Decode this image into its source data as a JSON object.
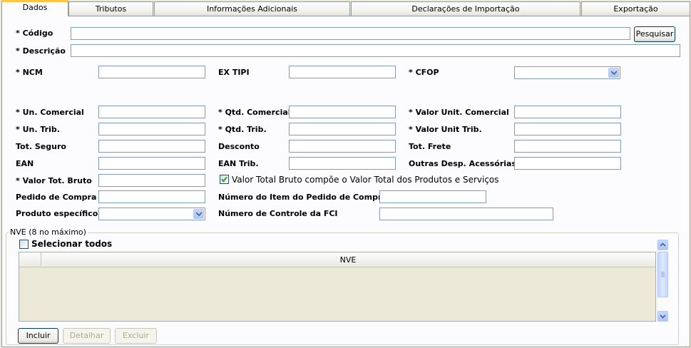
{
  "tabs": [
    {
      "label": "Dados"
    },
    {
      "label": "Tributos"
    },
    {
      "label": "Informações Adicionais"
    },
    {
      "label": "Declarações de Importação"
    },
    {
      "label": "Exportação"
    }
  ],
  "form": {
    "codigo_label": "* Código",
    "descricao_label": "* Descrição",
    "pesquisar_label": "Pesquisar",
    "ncm_label": "* NCM",
    "extipi_label": "EX TIPI",
    "cfop_label": "* CFOP",
    "un_comercial_label": "* Un. Comercial",
    "qtd_comercial_label": "* Qtd. Comercial",
    "valor_unit_comercial_label": "* Valor Unit. Comercial",
    "un_trib_label": "* Un. Trib.",
    "qtd_trib_label": "* Qtd. Trib.",
    "valor_unit_trib_label": "* Valor Unit Trib.",
    "tot_seguro_label": "Tot. Seguro",
    "desconto_label": "Desconto",
    "tot_frete_label": "Tot. Frete",
    "ean_label": "EAN",
    "ean_trib_label": "EAN Trib.",
    "outras_desp_label": "Outras Desp. Acessórias",
    "valor_tot_bruto_label": "* Valor Tot. Bruto",
    "compoe_total_label": "Valor Total Bruto compõe o Valor Total dos Produtos e Serviços",
    "compoe_total_checked": true,
    "pedido_compra_label": "Pedido de Compra",
    "numero_item_pedido_label": "Número do Item do Pedido de Compra",
    "produto_especifico_label": "Produto específico",
    "numero_controle_fci_label": "Número de Controle da FCI"
  },
  "nve": {
    "group_title": "NVE (8 no máximo)",
    "select_all_label": "Selecionar todos",
    "select_all_checked": false,
    "column_header": "NVE"
  },
  "actions": {
    "incluir_label": "Incluir",
    "detalhar_label": "Detalhar",
    "excluir_label": "Excluir"
  },
  "colors": {
    "window_bg": "#ece9d8",
    "panel_bg": "#fcfcfe",
    "field_border": "#7f9db9",
    "tab_active_accent": "#ffc83c",
    "button_border": "#003c74"
  }
}
